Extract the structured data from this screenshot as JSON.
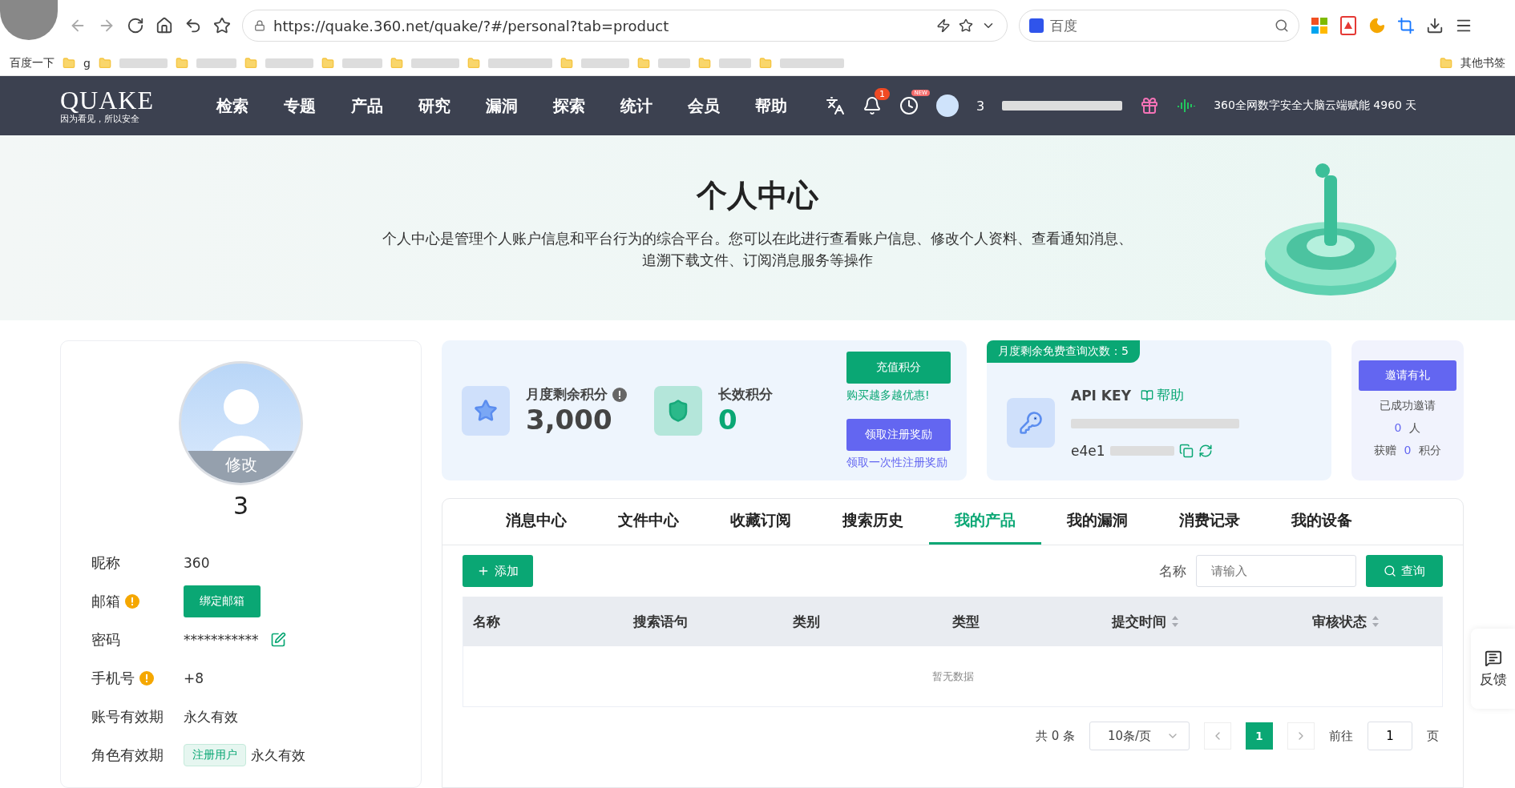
{
  "browser": {
    "url": "https://quake.360.net/quake/?#/personal?tab=product",
    "search_placeholder": "百度",
    "bookmarks": [
      "百度一下",
      "g"
    ],
    "other_bookmarks": "其他书签"
  },
  "nav": {
    "logo": "QUAKE",
    "slogan": "因为看见，所以安全",
    "items": [
      {
        "label": "检索",
        "selected": false
      },
      {
        "label": "专题",
        "selected": false
      },
      {
        "label": "产品",
        "selected": false
      },
      {
        "label": "研究",
        "selected": false
      },
      {
        "label": "漏洞",
        "selected": false
      },
      {
        "label": "探索",
        "selected": false
      },
      {
        "label": "统计",
        "selected": false
      },
      {
        "label": "会员",
        "selected": false
      },
      {
        "label": "帮助",
        "selected": false
      }
    ],
    "notification_count": "1",
    "new_badge": "NEW",
    "username": "3",
    "status": "360全网数字安全大脑云端赋能 4960 天"
  },
  "hero": {
    "title": "个人中心",
    "description": [
      "个人中心是管理个人账户信息和平台行为的综合平台。您可以在此进行查看账户信息、修改个人资料、查看通知消息、",
      "追溯下载文件、订阅消息服务等操作"
    ]
  },
  "profile": {
    "avatar_overlay": "修改",
    "username": "3",
    "fields": [
      {
        "label": "昵称",
        "kind": "text",
        "value": "360",
        "warning": false
      },
      {
        "label": "邮箱",
        "kind": "button",
        "value": "绑定邮箱",
        "warning": true
      },
      {
        "label": "密码",
        "kind": "masked",
        "value": "***********",
        "warning": false
      },
      {
        "label": "手机号",
        "kind": "text",
        "value": "+8",
        "warning": true
      },
      {
        "label": "账号有效期",
        "kind": "text",
        "value": "永久有效",
        "warning": false
      },
      {
        "label": "角色有效期",
        "kind": "tag",
        "tag": "注册用户",
        "value": "永久有效",
        "warning": false
      }
    ]
  },
  "points": {
    "monthly": {
      "label": "月度剩余积分",
      "value": "3,000"
    },
    "long_term": {
      "label": "长效积分",
      "value": "0"
    },
    "recharge_button": "充值积分",
    "recharge_hint": "购买越多越优惠!",
    "reward_button": "领取注册奖励",
    "reward_link": "领取一次性注册奖励"
  },
  "api": {
    "quota": "月度剩余免费查询次数：5",
    "title": "API KEY",
    "help": "帮助",
    "key": "e4e1"
  },
  "invite": {
    "button": "邀请有礼",
    "invited_label": "已成功邀请",
    "invited_count": "0",
    "invited_unit": "人",
    "gift_label": "获赠",
    "gift_count": "0",
    "gift_unit": "积分"
  },
  "tabs": [
    {
      "label": "消息中心",
      "selected": false
    },
    {
      "label": "文件中心",
      "selected": false
    },
    {
      "label": "收藏订阅",
      "selected": false
    },
    {
      "label": "搜索历史",
      "selected": false
    },
    {
      "label": "我的产品",
      "selected": true
    },
    {
      "label": "我的漏洞",
      "selected": false
    },
    {
      "label": "消费记录",
      "selected": false
    },
    {
      "label": "我的设备",
      "selected": false
    }
  ],
  "toolbar": {
    "add": "添加",
    "filter_label": "名称",
    "placeholder": "请输入",
    "search": "查询"
  },
  "table": {
    "columns": [
      {
        "label": "名称",
        "sortable": false
      },
      {
        "label": "搜索语句",
        "sortable": false
      },
      {
        "label": "类别",
        "sortable": false
      },
      {
        "label": "类型",
        "sortable": false
      },
      {
        "label": "提交时间",
        "sortable": true
      },
      {
        "label": "审核状态",
        "sortable": true
      }
    ],
    "empty": "暂无数据"
  },
  "pagination": {
    "total": "共 0 条",
    "page_size": "10条/页",
    "pages": [
      {
        "label": "1",
        "selected": true
      }
    ],
    "goto": "前往",
    "goto_value": "1",
    "unit": "页"
  },
  "feedback": "反馈"
}
